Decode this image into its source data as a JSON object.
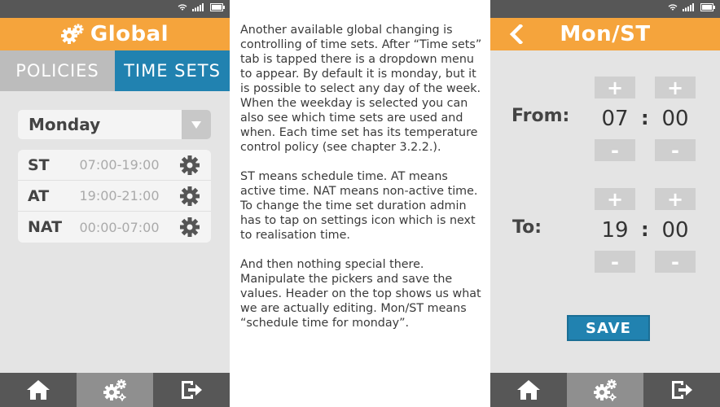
{
  "left_screen": {
    "header": {
      "title": "Global"
    },
    "tabs": [
      {
        "label": "POLICIES",
        "active": false
      },
      {
        "label": "TIME SETS",
        "active": true
      }
    ],
    "dropdown": {
      "value": "Monday"
    },
    "time_sets": [
      {
        "code": "ST",
        "range": "07:00-19:00"
      },
      {
        "code": "AT",
        "range": "19:00-21:00"
      },
      {
        "code": "NAT",
        "range": "00:00-07:00"
      }
    ]
  },
  "description": {
    "paragraphs": [
      "Another available global changing is controlling of time sets. After “Time sets” tab is tapped there is a dropdown menu to appear. By default it is monday, but it is possible to select any day of the week. When the weekday is selected you can also see which time sets are used and when. Each time set has its temperature control policy (see chapter 3.2.2.).",
      "ST means schedule time. AT means active time. NAT means non-active time. To change the time set duration admin has to tap on settings icon which is next to realisation time.",
      "And then nothing special there. Manipulate the pickers and save the values. Header on the top shows us what we are actually editing. Mon/ST means “schedule time for monday”."
    ]
  },
  "right_screen": {
    "header": {
      "title": "Mon/ST"
    },
    "from": {
      "label": "From:",
      "hours": "07",
      "minutes": "00"
    },
    "to": {
      "label": "To:",
      "hours": "19",
      "minutes": "00"
    },
    "separator": ":",
    "plus_label": "+",
    "minus_label": "-",
    "save_label": "SAVE"
  },
  "colors": {
    "accent_orange": "#f5a43c",
    "accent_blue": "#2182b0",
    "bar_dark": "#575757",
    "bar_active": "#8f8f8f",
    "panel_bg": "#e4e4e4"
  },
  "icons": {
    "header_left": "gear-cluster-icon",
    "header_right_back": "chevron-left-icon",
    "time_set_settings": "gear-icon",
    "bottom_nav": [
      "home-icon",
      "gear-cluster-icon",
      "logout-icon"
    ],
    "status": [
      "wifi-icon",
      "signal-icon",
      "battery-icon"
    ]
  }
}
